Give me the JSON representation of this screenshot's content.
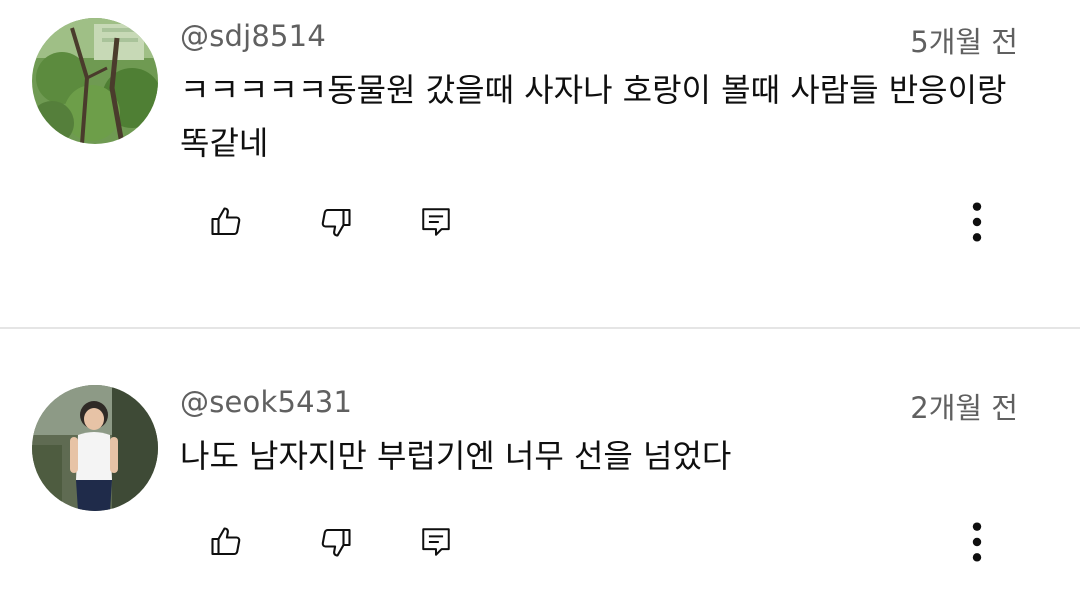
{
  "comments": [
    {
      "author": "@sdj8514",
      "time": "5개월 전",
      "text": "ㅋㅋㅋㅋㅋ동물원 갔을때 사자나 호랑이 볼때 사람들 반응이랑 똑같네",
      "avatar": "avatar-tree-photo"
    },
    {
      "author": "@seok5431",
      "time": "2개월 전",
      "text": "나도 남자지만 부럽기엔 너무 선을 넘었다",
      "avatar": "avatar-person-photo"
    }
  ],
  "icons": {
    "like": "thumbs-up-icon",
    "dislike": "thumbs-down-icon",
    "reply": "reply-comment-icon",
    "more": "more-vertical-icon"
  },
  "colors": {
    "secondary_text": "#606060",
    "primary_text": "#0f0f0f",
    "divider": "#e5e5e5",
    "icon": "#0f0f0f"
  }
}
